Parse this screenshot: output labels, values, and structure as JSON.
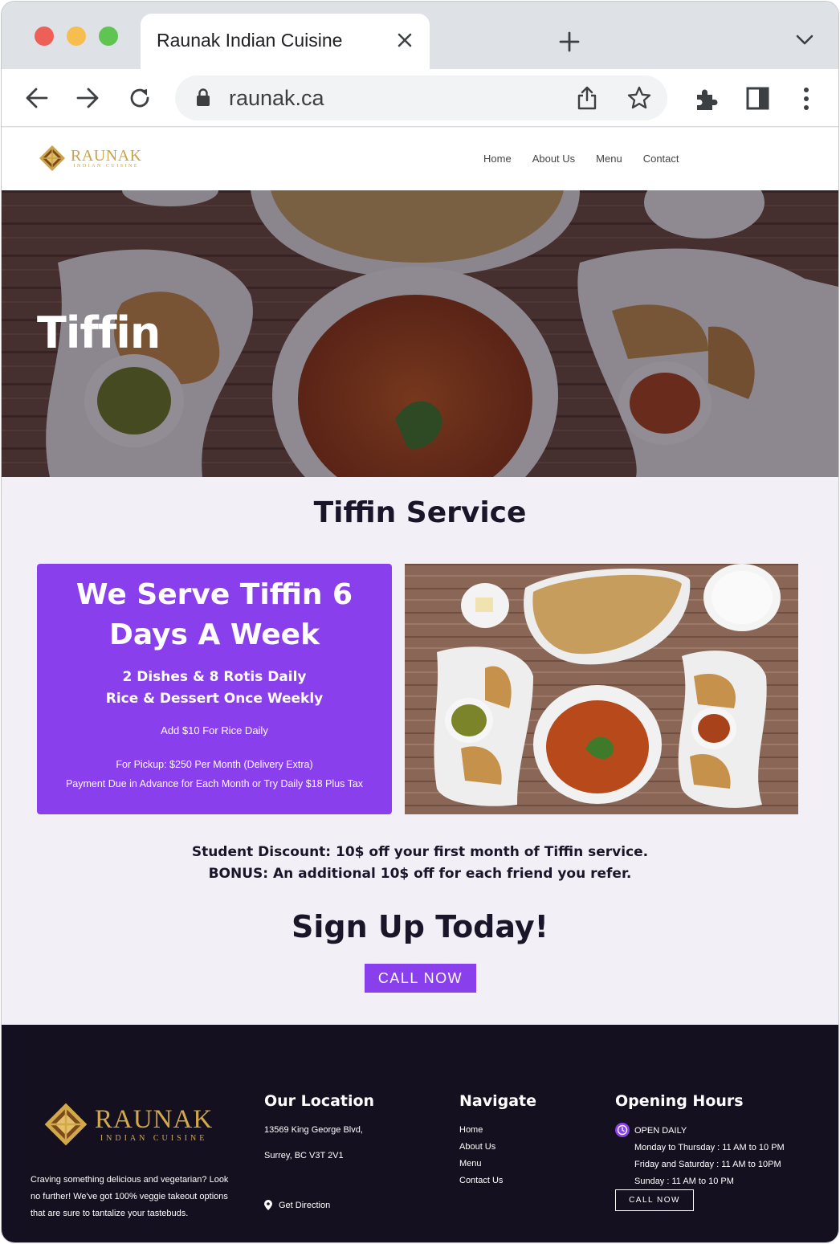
{
  "browser": {
    "tab_title": "Raunak Indian Cuisine",
    "url": "raunak.ca",
    "icons": [
      "close-icon",
      "plus-icon",
      "chevron-down-icon",
      "back-arrow-icon",
      "forward-arrow-icon",
      "reload-icon",
      "lock-icon",
      "share-icon",
      "star-icon",
      "extensions-icon",
      "sidepanel-icon",
      "more-vert-icon"
    ]
  },
  "header": {
    "logo": {
      "name": "RAUNAK",
      "tagline": "INDIAN CUISINE"
    },
    "nav": [
      "Home",
      "About Us",
      "Menu",
      "Contact"
    ]
  },
  "hero": {
    "title": "Tiffin"
  },
  "main": {
    "section_title": "Tiffin Service",
    "promo": {
      "headline": "We Serve Tiffin 6 Days A Week",
      "sub_line1": "2 Dishes & 8 Rotis Daily",
      "sub_line2": "Rice & Dessert Once Weekly",
      "rice_addon": "Add $10 For Rice Daily",
      "price_line1": "For Pickup: $250 Per Month (Delivery Extra)",
      "price_line2": "Payment Due in Advance for Each Month or Try Daily $18 Plus Tax"
    },
    "discount_line1": "Student Discount: 10$ off your first month of Tiffin service.",
    "discount_line2": "BONUS: An additional 10$ off for each friend you refer.",
    "signup_title": "Sign Up Today!",
    "call_button": "CALL NOW"
  },
  "footer": {
    "logo": {
      "name": "RAUNAK",
      "tagline": "INDIAN CUISINE"
    },
    "about": "Craving something delicious and vegetarian? Look no further! We've got 100% veggie takeout options that are sure to tantalize your tastebuds.",
    "location": {
      "title": "Our Location",
      "address_line1": "13569 King George Blvd,",
      "address_line2": "Surrey, BC V3T 2V1",
      "directions": "Get Direction"
    },
    "navigate": {
      "title": "Navigate",
      "links": [
        "Home",
        "About Us",
        "Menu",
        "Contact Us"
      ]
    },
    "hours": {
      "title": "Opening Hours",
      "status": "OPEN DAILY",
      "lines": [
        "Monday to Thursday : 11 AM to 10 PM",
        "Friday and Saturday : 11 AM to 10PM",
        "Sunday : 11 AM to 10 PM"
      ],
      "call_button": "CALL NOW"
    }
  },
  "colors": {
    "accent": "#8a3fec",
    "footer_bg": "#15101f",
    "gold": "#c9a24a",
    "page_bg": "#f2f0f6"
  }
}
